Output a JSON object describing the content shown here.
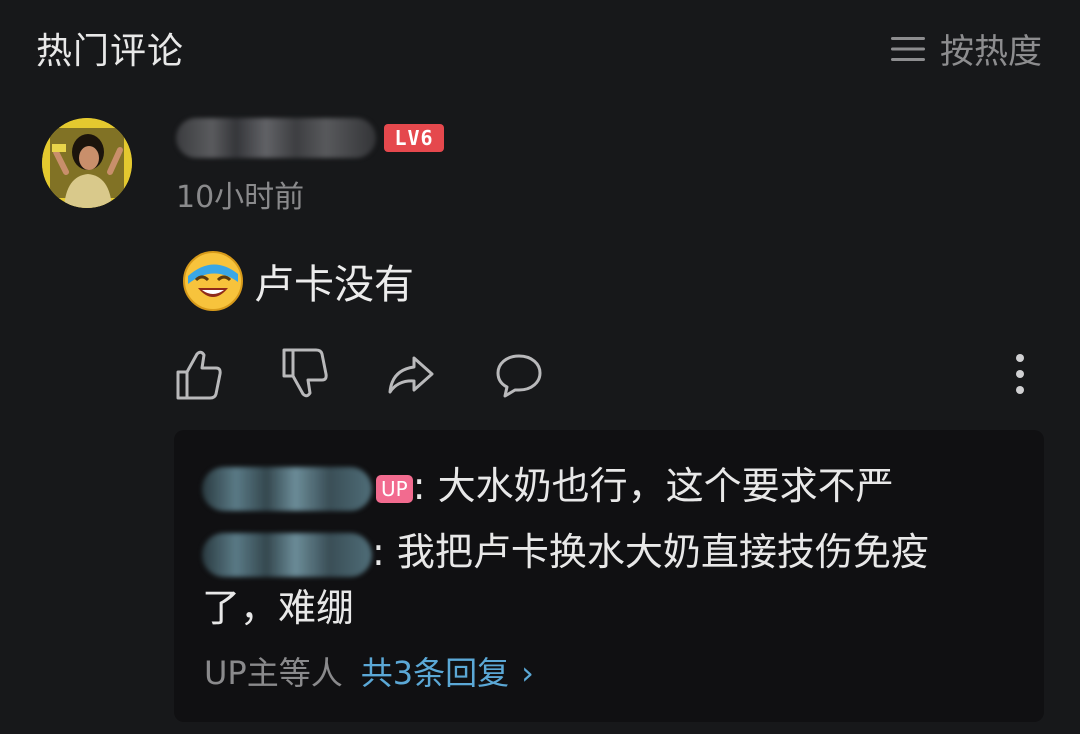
{
  "header": {
    "title": "热门评论",
    "sort_label": "按热度"
  },
  "comment": {
    "level_badge": "LV6",
    "timestamp": "10小时前",
    "text": "卢卡没有"
  },
  "replies": {
    "items": [
      {
        "up_badge": "UP",
        "text": ": 大水奶也行，这个要求不严"
      },
      {
        "text_line1": ": 我把卢卡换水大奶直接技伤免疫",
        "text_line2": "了，难绷"
      }
    ],
    "footer_prefix": "UP主等人",
    "footer_count": "共3条回复"
  },
  "icons": {
    "sort": "menu-icon",
    "like": "thumbs-up-icon",
    "dislike": "thumbs-down-icon",
    "share": "share-icon",
    "reply": "comment-bubble-icon",
    "more": "more-vertical-icon"
  },
  "colors": {
    "background": "#17181a",
    "reply_box": "#101012",
    "level_badge": "#e5484d",
    "up_badge": "#f26b8f",
    "link_blue": "#5ba8d6"
  }
}
